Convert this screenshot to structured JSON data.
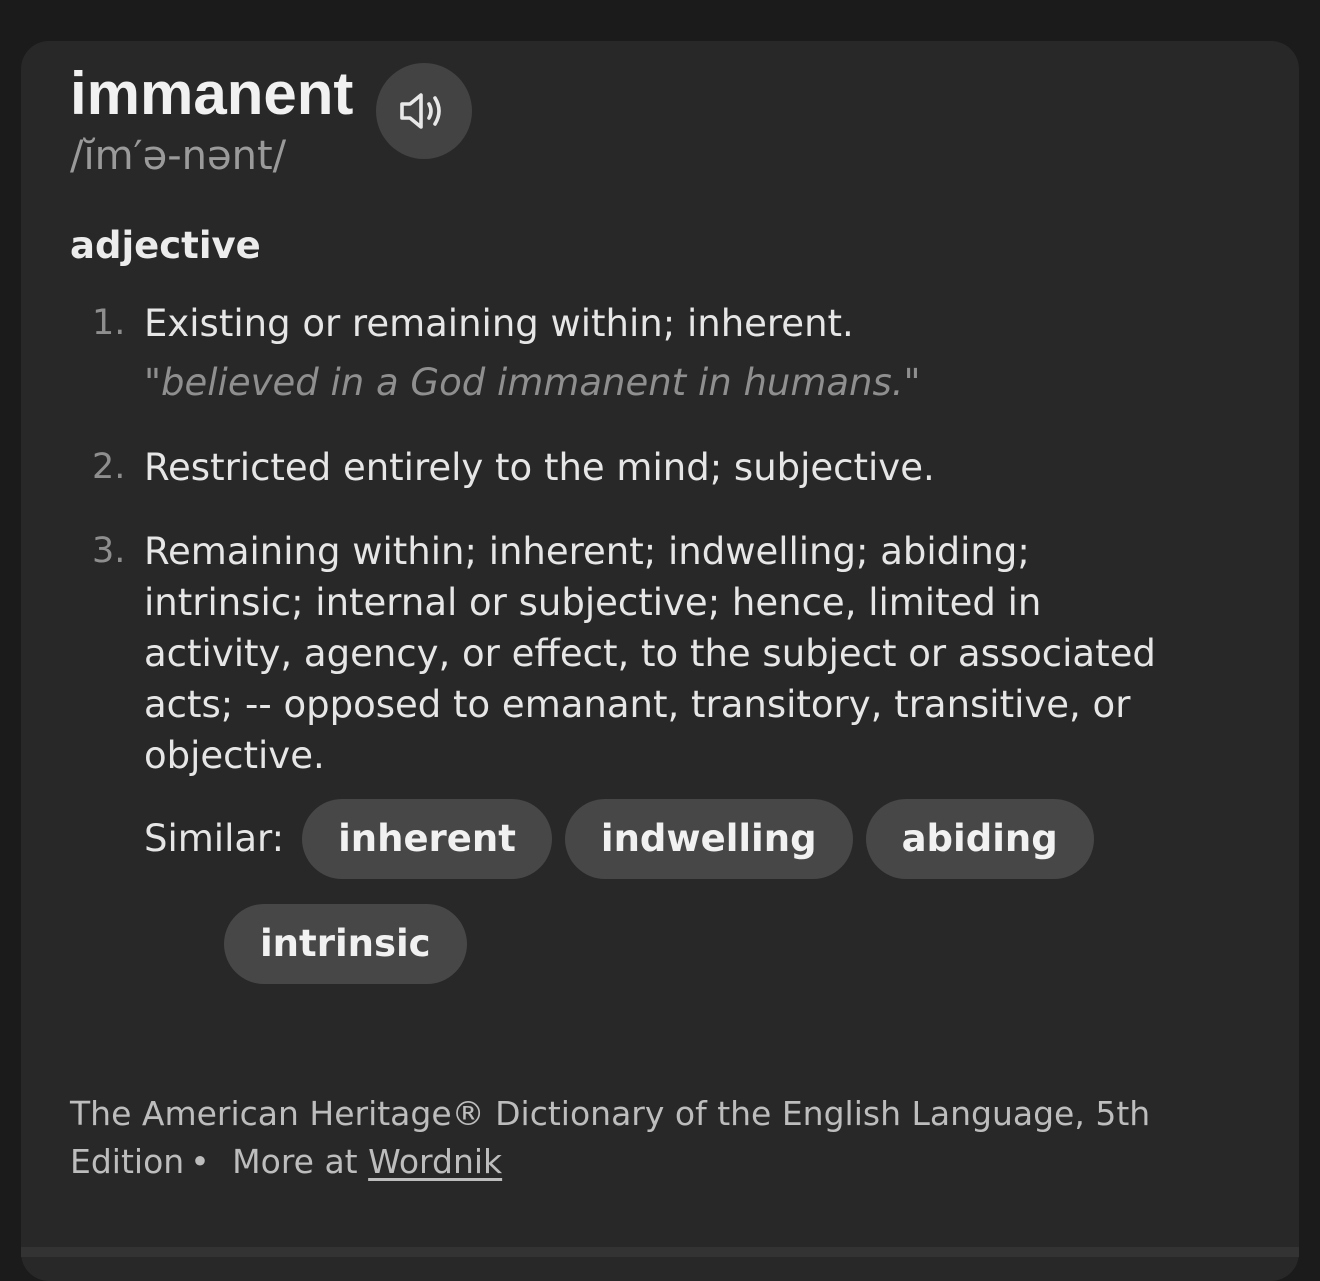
{
  "entry": {
    "word": "immanent",
    "phonetic": "/ĭm′ə-nənt/",
    "audio_icon": "speaker-icon",
    "part_of_speech": "adjective"
  },
  "definitions": [
    {
      "number": "1.",
      "text": "Existing or remaining within; inherent.",
      "example": "\"believed in a God immanent in humans.\""
    },
    {
      "number": "2.",
      "text": "Restricted entirely to the mind; subjective."
    },
    {
      "number": "3.",
      "text": "Remaining within; inherent; indwelling; abiding; intrinsic; internal or subjective; hence, limited in activity, agency, or effect, to the subject or associated acts; -- opposed to emanant, transitory, transitive, or objective."
    }
  ],
  "similar": {
    "label": "Similar:",
    "chips": [
      "inherent",
      "indwelling",
      "abiding",
      "intrinsic"
    ]
  },
  "source": {
    "text": "The American Heritage® Dictionary of the English Language, 5th Edition",
    "separator": "•",
    "more_at": "More at",
    "link": "Wordnik"
  },
  "colors": {
    "background": "#1b1b1b",
    "card": "#282828",
    "chip": "#474747",
    "audio_button": "#434343"
  }
}
